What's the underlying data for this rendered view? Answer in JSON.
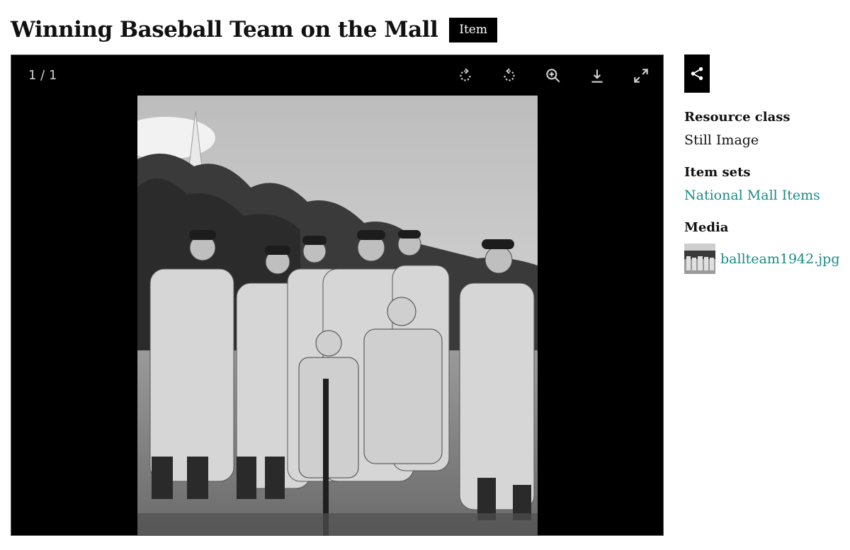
{
  "page": {
    "title": "Winning Baseball Team on the Mall",
    "type_badge": "Item"
  },
  "viewer": {
    "page_counter": "1 / 1",
    "toolbar": [
      {
        "icon": "rotate-right-icon"
      },
      {
        "icon": "rotate-left-icon"
      },
      {
        "icon": "zoom-in-icon"
      },
      {
        "icon": "download-icon"
      },
      {
        "icon": "fullscreen-icon"
      }
    ],
    "image_style": "black-and-white photograph"
  },
  "sidebar": {
    "share_icon": "share-icon",
    "resource_class_label": "Resource class",
    "resource_class_value": "Still Image",
    "item_sets_label": "Item sets",
    "item_sets_value": "National Mall Items",
    "media_label": "Media",
    "media_file": "ballteam1942.jpg"
  },
  "colors": {
    "link": "#1a8a86",
    "viewer_bg": "#000000",
    "badge_bg": "#000000"
  }
}
